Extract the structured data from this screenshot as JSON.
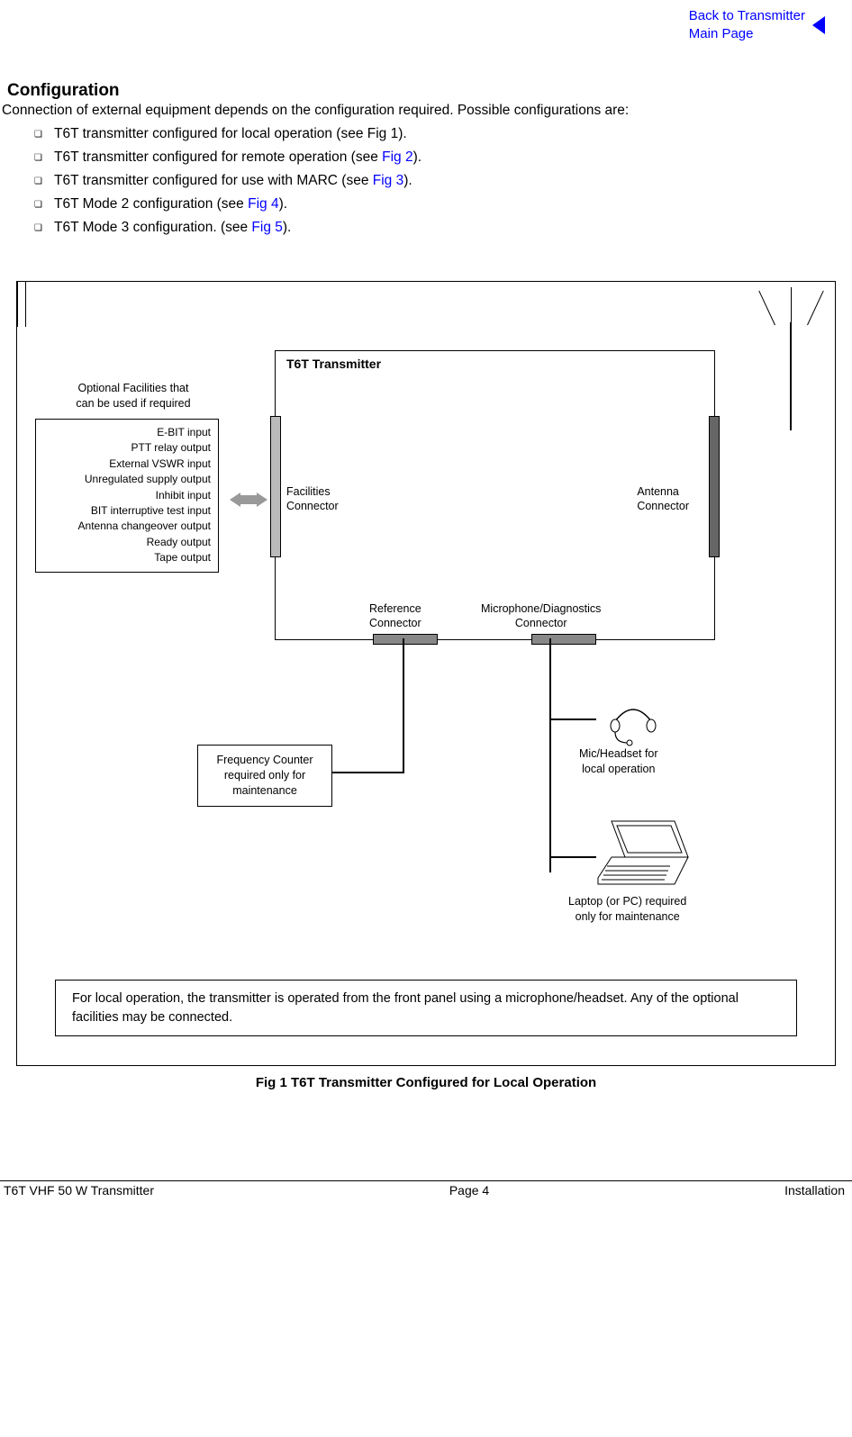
{
  "nav": {
    "back_line1": "Back to Transmitter",
    "back_line2": "Main Page"
  },
  "heading": "Configuration",
  "intro": "Connection of external equipment depends on the configuration required. Possible configurations are:",
  "bullets": [
    {
      "pre": "T6T transmitter configured for local operation (see Fig 1)."
    },
    {
      "pre": "T6T transmitter configured for remote operation (see ",
      "link": "Fig 2",
      "post": ")."
    },
    {
      "pre": "T6T transmitter configured for use with MARC (see ",
      "link": "Fig 3",
      "post": ")."
    },
    {
      "pre": "T6T Mode 2 configuration (see ",
      "link": "Fig 4",
      "post": ")."
    },
    {
      "pre": "T6T Mode 3 configuration. (see ",
      "link": "Fig 5",
      "post": ")."
    }
  ],
  "fig": {
    "tx_title": "T6T Transmitter",
    "facilities": "Facilities\nConnector",
    "antenna": "Antenna\nConnector",
    "reference": "Reference\nConnector",
    "micdiag": "Microphone/Diagnostics\nConnector",
    "opt_label": "Optional Facilities that\ncan be used if required",
    "opt_items": [
      "E-BIT input",
      "PTT relay output",
      "External VSWR input",
      "Unregulated supply output",
      "Inhibit input",
      "BIT interruptive test input",
      "Antenna changeover output",
      "Ready output",
      "Tape output"
    ],
    "freq_box": "Frequency Counter\nrequired only for\nmaintenance",
    "headset_lbl": "Mic/Headset for\nlocal operation",
    "laptop_lbl": "Laptop (or PC) required\nonly for maintenance",
    "note": "For local operation, the transmitter is operated from the front panel using a microphone/headset. Any of the optional facilities may be connected.",
    "caption": "Fig 1  T6T Transmitter Configured for Local Operation"
  },
  "footer": {
    "left": "T6T VHF 50 W Transmitter",
    "center": "Page 4",
    "right": "Installation"
  }
}
